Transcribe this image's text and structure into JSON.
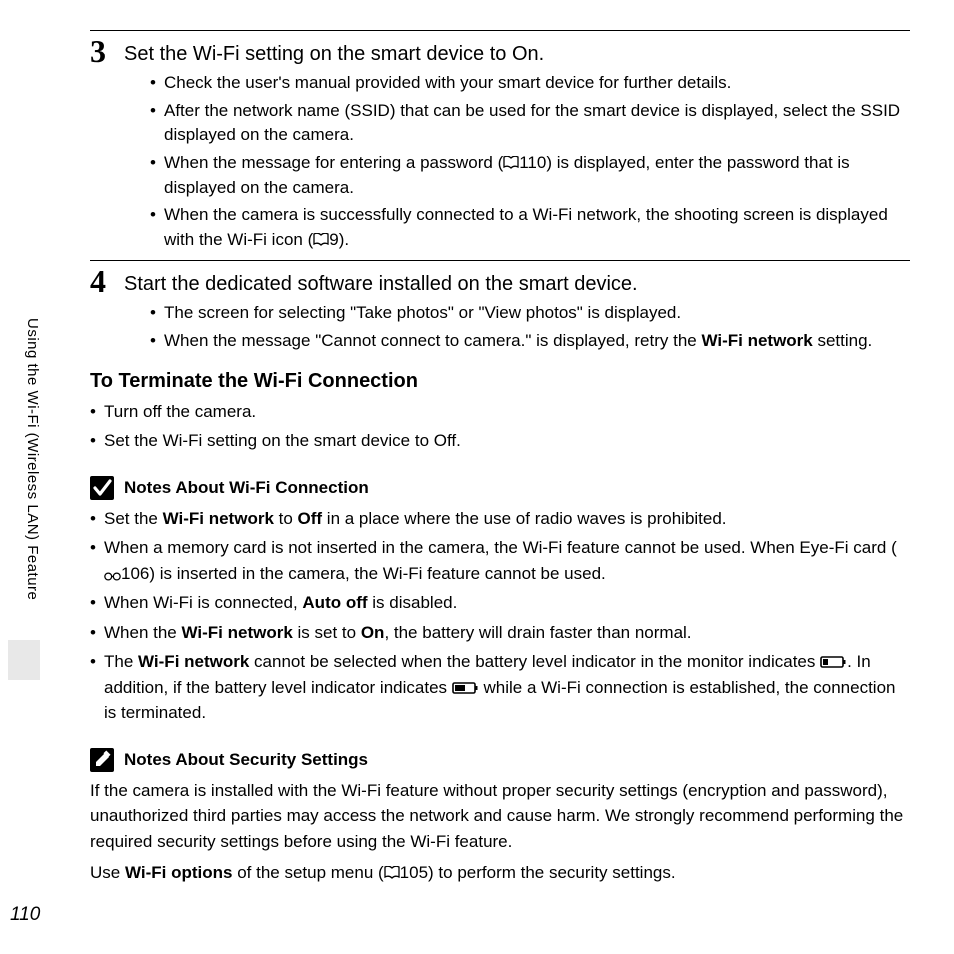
{
  "side_label": "Using the Wi-Fi (Wireless LAN) Feature",
  "page_number": "110",
  "step3": {
    "num": "3",
    "title": "Set the Wi-Fi setting on the smart device to On.",
    "b1": "Check the user's manual provided with your smart device for further details.",
    "b2": "After the network name (SSID) that can be used for the smart device is displayed, select the SSID displayed on the camera.",
    "b3a": "When the message for entering a password (",
    "b3ref": "110",
    "b3b": ") is displayed, enter the password that is displayed on the camera.",
    "b4a": "When the camera is successfully connected to a Wi-Fi network, the shooting screen is displayed with the Wi-Fi icon (",
    "b4ref": "9",
    "b4b": ")."
  },
  "step4": {
    "num": "4",
    "title": "Start the dedicated software installed on the smart device.",
    "b1": "The screen for selecting \"Take photos\" or \"View photos\" is displayed.",
    "b2a": "When the message \"Cannot connect to camera.\" is displayed, retry the ",
    "b2bold": "Wi-Fi network",
    "b2b": " setting."
  },
  "terminate": {
    "heading": "To Terminate the Wi-Fi Connection",
    "b1": "Turn off the camera.",
    "b2": "Set the Wi-Fi setting on the smart device to Off."
  },
  "notes1": {
    "heading": "Notes About Wi-Fi Connection",
    "l1a": "Set the ",
    "l1b": "Wi-Fi network",
    "l1c": " to ",
    "l1d": "Off",
    "l1e": " in a place where the use of radio waves is prohibited.",
    "l2a": "When a memory card is not inserted in the camera, the Wi-Fi feature cannot be used. When Eye-Fi card (",
    "l2ref": "106",
    "l2b": ") is inserted in the camera, the Wi-Fi feature cannot be used.",
    "l3a": "When Wi-Fi is connected, ",
    "l3b": "Auto off",
    "l3c": " is disabled.",
    "l4a": "When the ",
    "l4b": "Wi-Fi network",
    "l4c": " is set to ",
    "l4d": "On",
    "l4e": ", the battery will drain faster than normal.",
    "l5a": "The ",
    "l5b": "Wi-Fi network",
    "l5c": " cannot be selected when the battery level indicator in the monitor indicates ",
    "l5d": ". In addition, if the battery level indicator indicates ",
    "l5e": " while a Wi-Fi connection is established, the connection is terminated."
  },
  "notes2": {
    "heading": "Notes About Security Settings",
    "p1": "If the camera is installed with the Wi-Fi feature without proper security settings (encryption and password), unauthorized third parties may access the network and cause harm. We strongly recommend performing the required security settings before using the Wi-Fi feature.",
    "p2a": "Use ",
    "p2b": "Wi-Fi options",
    "p2c": " of the setup menu (",
    "p2ref": "105",
    "p2d": ") to perform the security settings."
  }
}
